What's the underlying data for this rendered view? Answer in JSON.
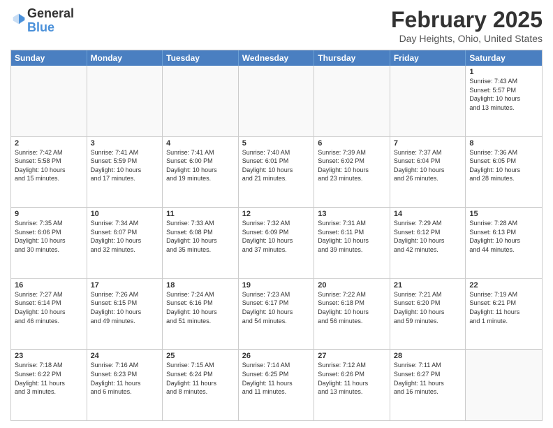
{
  "logo": {
    "general": "General",
    "blue": "Blue"
  },
  "title": "February 2025",
  "subtitle": "Day Heights, Ohio, United States",
  "days": [
    "Sunday",
    "Monday",
    "Tuesday",
    "Wednesday",
    "Thursday",
    "Friday",
    "Saturday"
  ],
  "weeks": [
    [
      {
        "num": "",
        "lines": []
      },
      {
        "num": "",
        "lines": []
      },
      {
        "num": "",
        "lines": []
      },
      {
        "num": "",
        "lines": []
      },
      {
        "num": "",
        "lines": []
      },
      {
        "num": "",
        "lines": []
      },
      {
        "num": "1",
        "lines": [
          "Sunrise: 7:43 AM",
          "Sunset: 5:57 PM",
          "Daylight: 10 hours",
          "and 13 minutes."
        ]
      }
    ],
    [
      {
        "num": "2",
        "lines": [
          "Sunrise: 7:42 AM",
          "Sunset: 5:58 PM",
          "Daylight: 10 hours",
          "and 15 minutes."
        ]
      },
      {
        "num": "3",
        "lines": [
          "Sunrise: 7:41 AM",
          "Sunset: 5:59 PM",
          "Daylight: 10 hours",
          "and 17 minutes."
        ]
      },
      {
        "num": "4",
        "lines": [
          "Sunrise: 7:41 AM",
          "Sunset: 6:00 PM",
          "Daylight: 10 hours",
          "and 19 minutes."
        ]
      },
      {
        "num": "5",
        "lines": [
          "Sunrise: 7:40 AM",
          "Sunset: 6:01 PM",
          "Daylight: 10 hours",
          "and 21 minutes."
        ]
      },
      {
        "num": "6",
        "lines": [
          "Sunrise: 7:39 AM",
          "Sunset: 6:02 PM",
          "Daylight: 10 hours",
          "and 23 minutes."
        ]
      },
      {
        "num": "7",
        "lines": [
          "Sunrise: 7:37 AM",
          "Sunset: 6:04 PM",
          "Daylight: 10 hours",
          "and 26 minutes."
        ]
      },
      {
        "num": "8",
        "lines": [
          "Sunrise: 7:36 AM",
          "Sunset: 6:05 PM",
          "Daylight: 10 hours",
          "and 28 minutes."
        ]
      }
    ],
    [
      {
        "num": "9",
        "lines": [
          "Sunrise: 7:35 AM",
          "Sunset: 6:06 PM",
          "Daylight: 10 hours",
          "and 30 minutes."
        ]
      },
      {
        "num": "10",
        "lines": [
          "Sunrise: 7:34 AM",
          "Sunset: 6:07 PM",
          "Daylight: 10 hours",
          "and 32 minutes."
        ]
      },
      {
        "num": "11",
        "lines": [
          "Sunrise: 7:33 AM",
          "Sunset: 6:08 PM",
          "Daylight: 10 hours",
          "and 35 minutes."
        ]
      },
      {
        "num": "12",
        "lines": [
          "Sunrise: 7:32 AM",
          "Sunset: 6:09 PM",
          "Daylight: 10 hours",
          "and 37 minutes."
        ]
      },
      {
        "num": "13",
        "lines": [
          "Sunrise: 7:31 AM",
          "Sunset: 6:11 PM",
          "Daylight: 10 hours",
          "and 39 minutes."
        ]
      },
      {
        "num": "14",
        "lines": [
          "Sunrise: 7:29 AM",
          "Sunset: 6:12 PM",
          "Daylight: 10 hours",
          "and 42 minutes."
        ]
      },
      {
        "num": "15",
        "lines": [
          "Sunrise: 7:28 AM",
          "Sunset: 6:13 PM",
          "Daylight: 10 hours",
          "and 44 minutes."
        ]
      }
    ],
    [
      {
        "num": "16",
        "lines": [
          "Sunrise: 7:27 AM",
          "Sunset: 6:14 PM",
          "Daylight: 10 hours",
          "and 46 minutes."
        ]
      },
      {
        "num": "17",
        "lines": [
          "Sunrise: 7:26 AM",
          "Sunset: 6:15 PM",
          "Daylight: 10 hours",
          "and 49 minutes."
        ]
      },
      {
        "num": "18",
        "lines": [
          "Sunrise: 7:24 AM",
          "Sunset: 6:16 PM",
          "Daylight: 10 hours",
          "and 51 minutes."
        ]
      },
      {
        "num": "19",
        "lines": [
          "Sunrise: 7:23 AM",
          "Sunset: 6:17 PM",
          "Daylight: 10 hours",
          "and 54 minutes."
        ]
      },
      {
        "num": "20",
        "lines": [
          "Sunrise: 7:22 AM",
          "Sunset: 6:18 PM",
          "Daylight: 10 hours",
          "and 56 minutes."
        ]
      },
      {
        "num": "21",
        "lines": [
          "Sunrise: 7:21 AM",
          "Sunset: 6:20 PM",
          "Daylight: 10 hours",
          "and 59 minutes."
        ]
      },
      {
        "num": "22",
        "lines": [
          "Sunrise: 7:19 AM",
          "Sunset: 6:21 PM",
          "Daylight: 11 hours",
          "and 1 minute."
        ]
      }
    ],
    [
      {
        "num": "23",
        "lines": [
          "Sunrise: 7:18 AM",
          "Sunset: 6:22 PM",
          "Daylight: 11 hours",
          "and 3 minutes."
        ]
      },
      {
        "num": "24",
        "lines": [
          "Sunrise: 7:16 AM",
          "Sunset: 6:23 PM",
          "Daylight: 11 hours",
          "and 6 minutes."
        ]
      },
      {
        "num": "25",
        "lines": [
          "Sunrise: 7:15 AM",
          "Sunset: 6:24 PM",
          "Daylight: 11 hours",
          "and 8 minutes."
        ]
      },
      {
        "num": "26",
        "lines": [
          "Sunrise: 7:14 AM",
          "Sunset: 6:25 PM",
          "Daylight: 11 hours",
          "and 11 minutes."
        ]
      },
      {
        "num": "27",
        "lines": [
          "Sunrise: 7:12 AM",
          "Sunset: 6:26 PM",
          "Daylight: 11 hours",
          "and 13 minutes."
        ]
      },
      {
        "num": "28",
        "lines": [
          "Sunrise: 7:11 AM",
          "Sunset: 6:27 PM",
          "Daylight: 11 hours",
          "and 16 minutes."
        ]
      },
      {
        "num": "",
        "lines": []
      }
    ]
  ]
}
